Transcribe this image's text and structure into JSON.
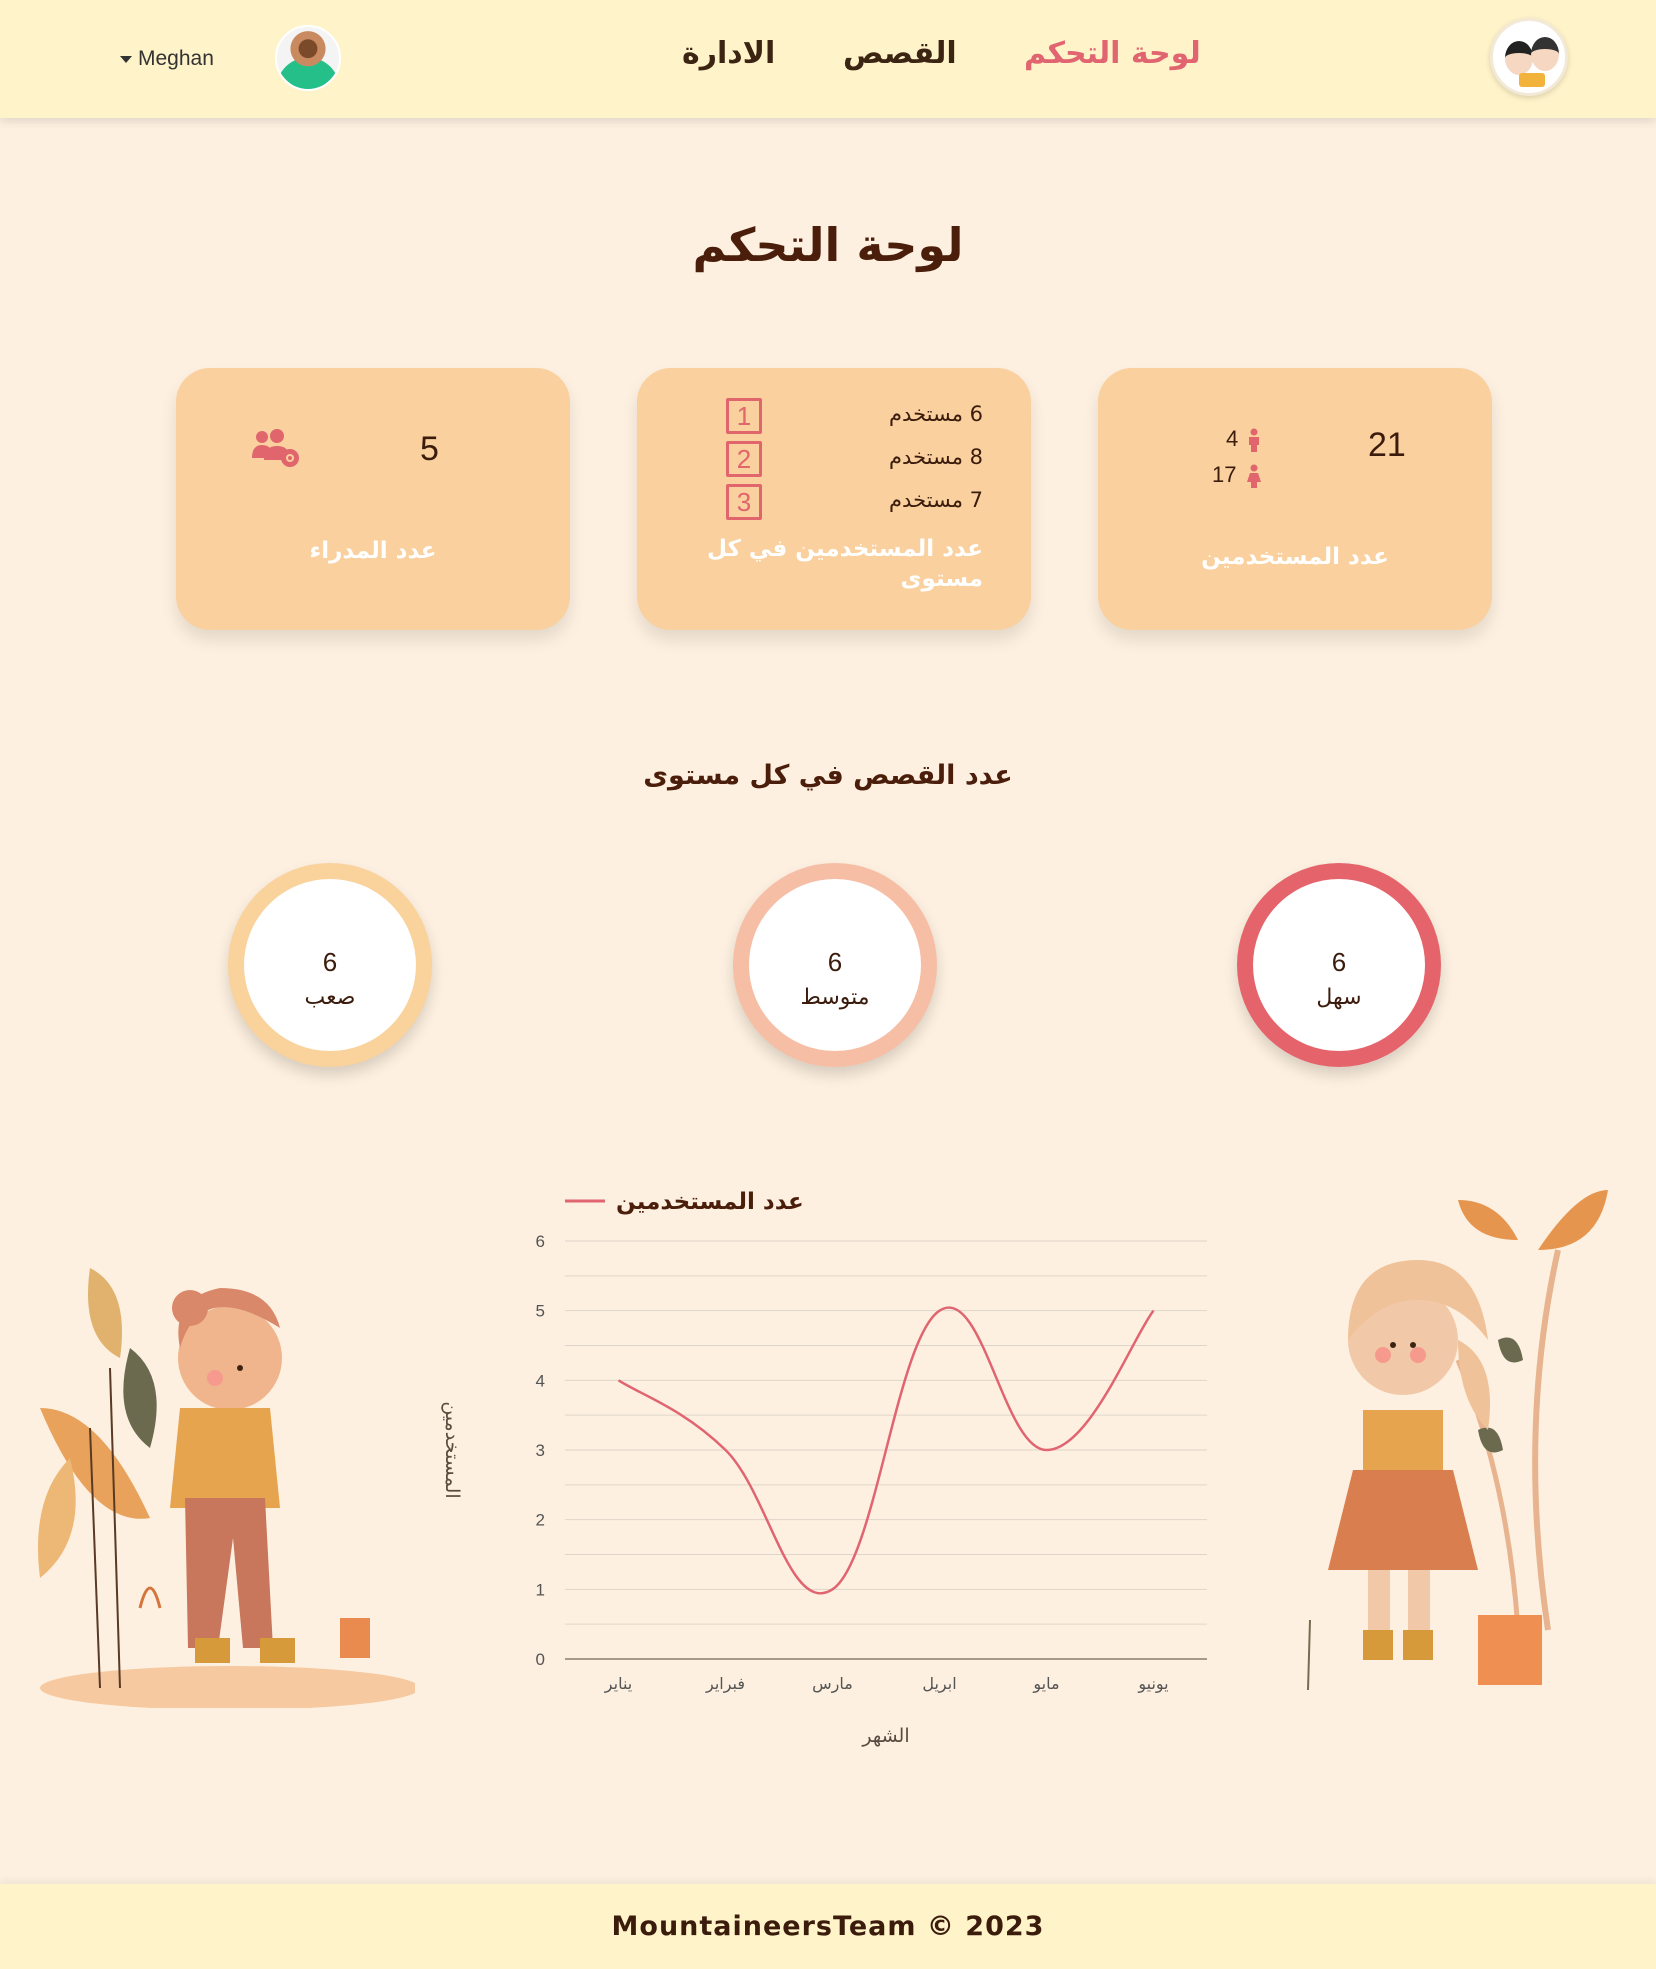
{
  "header": {
    "user_name": "Meghan",
    "nav": [
      {
        "label": "لوحة التحكم",
        "active": true
      },
      {
        "label": "القصص",
        "active": false
      },
      {
        "label": "الادارة",
        "active": false
      }
    ]
  },
  "page_title": "لوحة التحكم",
  "cards": {
    "users": {
      "total": "21",
      "male": "4",
      "female": "17",
      "label": "عدد المستخدمين"
    },
    "levels": {
      "rows": [
        {
          "level": "1",
          "text": "6 مستخدم"
        },
        {
          "level": "2",
          "text": "8 مستخدم"
        },
        {
          "level": "3",
          "text": "7 مستخدم"
        }
      ],
      "label_line1": "عدد المستخدمين في كل",
      "label_line2": "مستوى"
    },
    "admins": {
      "total": "5",
      "label": "عدد المدراء"
    }
  },
  "stories_section": {
    "title": "عدد القصص في كل مستوى",
    "rings": [
      {
        "count": "6",
        "label": "سهل",
        "color": "#e5646c"
      },
      {
        "count": "6",
        "label": "متوسط",
        "color": "#f7bea6"
      },
      {
        "count": "6",
        "label": "صعب",
        "color": "#f9d29c"
      }
    ]
  },
  "colors": {
    "accent": "#e06570",
    "card": "#f9d09e",
    "background": "#fdf0e0",
    "header": "#fff3c9"
  },
  "chart_data": {
    "type": "line",
    "legend": "عدد المستخدمين",
    "categories": [
      "يناير",
      "فبراير",
      "مارس",
      "ابريل",
      "مايو",
      "يونيو"
    ],
    "series": [
      {
        "name": "عدد المستخدمين",
        "values": [
          4,
          3,
          1,
          5,
          3,
          5
        ]
      }
    ],
    "xlabel": "الشهر",
    "ylabel": "المستخدمين",
    "ylim": [
      0,
      6
    ],
    "yticks": [
      0,
      1,
      2,
      3,
      4,
      5,
      6
    ],
    "line_color": "#e06570",
    "grid": true
  },
  "footer": {
    "text": "MountaineersTeam © 2023"
  }
}
